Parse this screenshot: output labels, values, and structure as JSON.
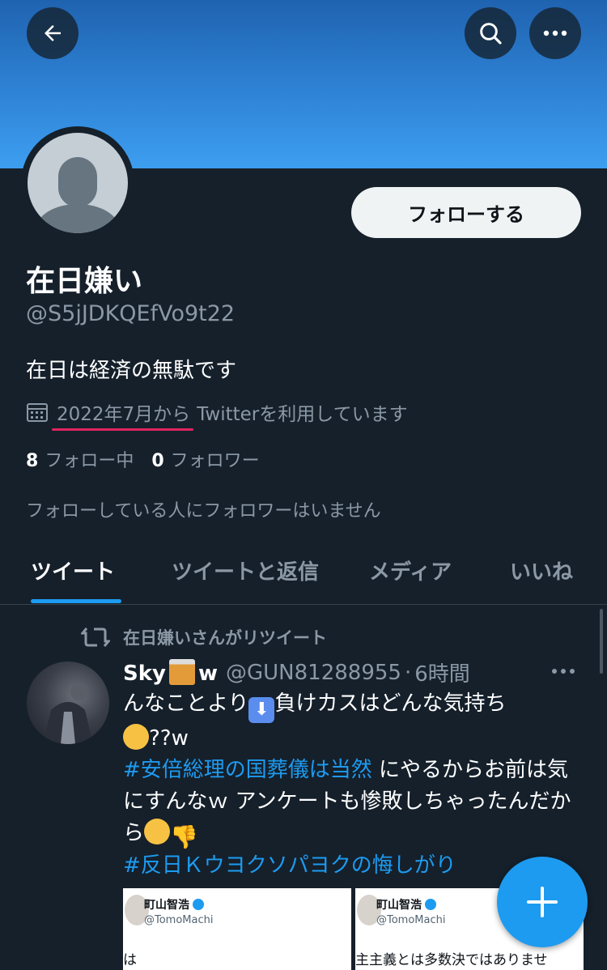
{
  "profile": {
    "display_name": "在日嫌い",
    "handle": "@S5jJDKQEfVo9t22",
    "bio": "在日は経済の無駄です",
    "joined_date": "2022年7月から",
    "joined_suffix": "Twitterを利用しています",
    "following_count": "8",
    "following_label": "フォロー中",
    "followers_count": "0",
    "followers_label": "フォロワー",
    "not_followed_note": "フォローしている人にフォロワーはいません",
    "follow_button": "フォローする"
  },
  "tabs": [
    {
      "label": "ツイート",
      "active": true
    },
    {
      "label": "ツイートと返信",
      "active": false
    },
    {
      "label": "メディア",
      "active": false
    },
    {
      "label": "いいね",
      "active": false
    }
  ],
  "tweet": {
    "retweeted_by": "在日嫌いさんがリツイート",
    "author_name_prefix": "Sky",
    "author_name_suffix": "w",
    "author_handle": "@GUN81288955",
    "separator": "·",
    "time": "6時間",
    "text_1": "んなことより",
    "text_2": "負けカスはどんな気持ち",
    "text_3": "??w",
    "hashtag_1": "#安倍総理の国葬儀は当然",
    "text_4": " にやるからお前は気にすんなｗ アンケートも惨敗しちゃったんだから",
    "hashtag_2": "#反日Ｋウヨクソパヨクの悔しがり",
    "media": [
      {
        "name": "町山智浩",
        "handle": "@TomoMachi",
        "text": "は"
      },
      {
        "name": "町山智浩",
        "handle": "@TomoMachi",
        "text": "主主義とは多数決ではありませ"
      }
    ]
  },
  "colors": {
    "background": "#15202b",
    "accent": "#1d9bf0",
    "secondary_text": "#8b98a5",
    "underline": "#e0245e"
  },
  "icons": [
    "back-arrow-icon",
    "search-icon",
    "more-icon",
    "calendar-icon",
    "retweet-icon",
    "more-dots-icon",
    "compose-plus-icon"
  ]
}
